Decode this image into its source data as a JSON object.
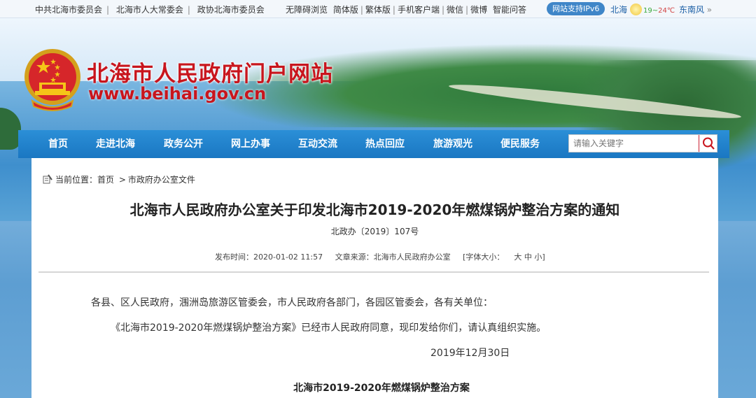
{
  "topbar": {
    "links": [
      "中共北海市委员会",
      "北海市人大常委会",
      "政协北海市委员会"
    ],
    "tools": [
      "无障碍浏览",
      "简体版",
      "繁体版",
      "手机客户端",
      "微信",
      "微博",
      "智能问答"
    ],
    "ipv6_label": "网站支持IPv6",
    "weather": {
      "city": "北海",
      "low": "19",
      "sep": "~",
      "high": "24",
      "unit": "℃",
      "wind": "东南风",
      "more": "»"
    }
  },
  "header": {
    "title": "北海市人民政府门户网站",
    "url": "www.beihai.gov.cn"
  },
  "nav": {
    "items": [
      "首页",
      "走进北海",
      "政务公开",
      "网上办事",
      "互动交流",
      "热点回应",
      "旅游观光",
      "便民服务"
    ],
    "search_placeholder": "请输入关键字"
  },
  "breadcrumb": {
    "label": "当前位置：",
    "home": "首页",
    "arrow": ">",
    "section": "市政府办公室文件"
  },
  "article": {
    "title": "北海市人民政府办公室关于印发北海市2019-2020年燃煤锅炉整治方案的通知",
    "doc_no": "北政办〔2019〕107号",
    "publish_time": "发布时间：2020-01-02 11:57",
    "source": "文章来源：北海市人民政府办公室",
    "font_size_prefix": "[字体大小：",
    "font_size_options": [
      "大",
      "中",
      "小"
    ],
    "font_size_suffix": "]",
    "recipients": "各县、区人民政府，涠洲岛旅游区管委会，市人民政府各部门，各园区管委会，各有关单位：",
    "body": "《北海市2019-2020年燃煤锅炉整治方案》已经市人民政府同意，现印发给你们，请认真组织实施。",
    "date": "2019年12月30日",
    "attachment_title": "北海市2019-2020年燃煤锅炉整治方案"
  },
  "colors": {
    "nav_blue": "#1f82cc",
    "title_red": "#c8151d",
    "ipv6_blue": "#3f86c8"
  }
}
